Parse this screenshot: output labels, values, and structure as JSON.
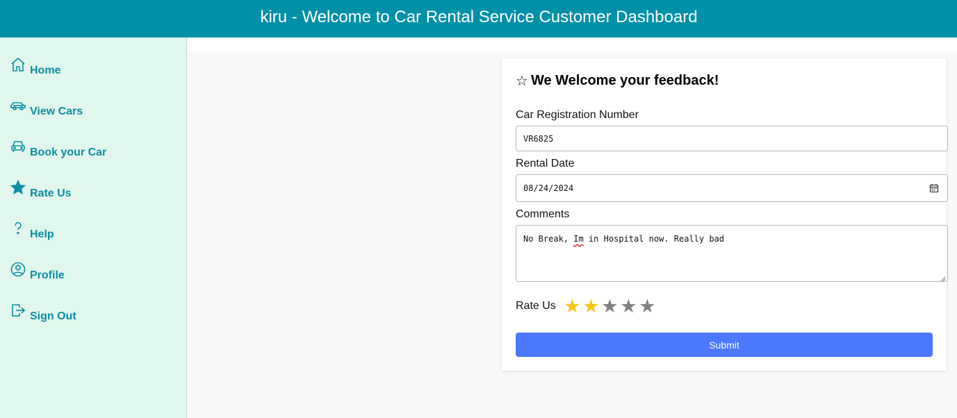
{
  "header": {
    "title": "kiru - Welcome to Car Rental Service Customer Dashboard"
  },
  "sidebar": {
    "items": [
      {
        "label": "Home",
        "icon": "home-icon"
      },
      {
        "label": "View Cars",
        "icon": "car-side-icon"
      },
      {
        "label": "Book your Car",
        "icon": "car-front-icon"
      },
      {
        "label": "Rate Us",
        "icon": "star-icon"
      },
      {
        "label": "Help",
        "icon": "question-icon"
      },
      {
        "label": "Profile",
        "icon": "user-circle-icon"
      },
      {
        "label": "Sign Out",
        "icon": "sign-out-icon"
      }
    ]
  },
  "feedback": {
    "title_icon": "☆",
    "title": "We Welcome your feedback!",
    "car_reg_label": "Car Registration Number",
    "car_reg_value": "VR6825",
    "rental_date_label": "Rental Date",
    "rental_date_value": "08/24/2024",
    "comments_label": "Comments",
    "comments_before": "No Break, ",
    "comments_misspelled": "Im",
    "comments_after": " in Hospital now. Really bad",
    "rate_label": "Rate Us",
    "rating": 2,
    "max_rating": 5,
    "submit_label": "Submit"
  },
  "colors": {
    "header_bg": "#0091a8",
    "sidebar_bg": "#e1f6ec",
    "nav_text": "#0b8fa3",
    "star_filled": "#f5c518",
    "star_empty": "#808080",
    "submit_bg": "#4b78ff"
  }
}
